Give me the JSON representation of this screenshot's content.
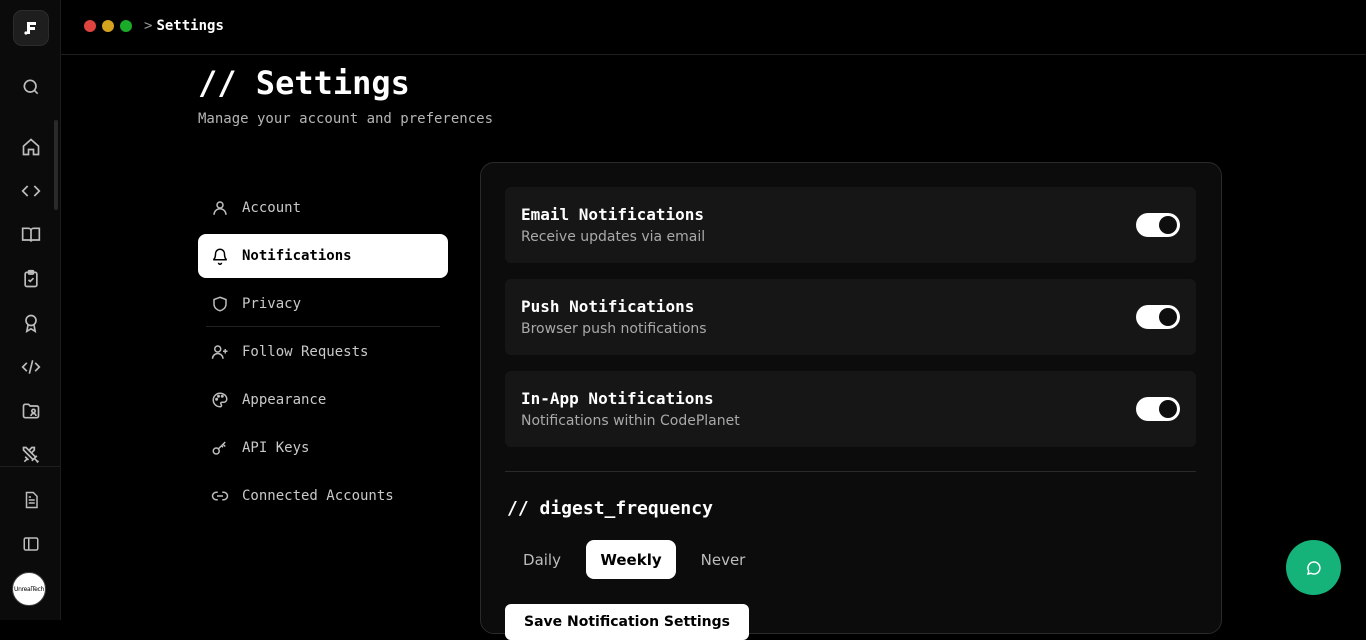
{
  "breadcrumb": {
    "separator": ">",
    "current": "Settings"
  },
  "window_controls": [
    "#e0443e",
    "#d6a31f",
    "#1aab29"
  ],
  "rail": {
    "icons": [
      "search-icon",
      "home-icon",
      "code-icon",
      "book-icon",
      "clipboard-check-icon",
      "award-icon",
      "code-tag-icon",
      "folder-user-icon",
      "swords-icon",
      "document-icon",
      "sidebar-toggle-icon"
    ],
    "avatar_text": "UnrealTech"
  },
  "header": {
    "title": "// Settings",
    "subtitle": "Manage your account and preferences"
  },
  "nav": {
    "items": [
      {
        "label": "Account",
        "icon": "user-icon"
      },
      {
        "label": "Notifications",
        "icon": "bell-icon",
        "active": true
      },
      {
        "label": "Privacy",
        "icon": "shield-icon"
      },
      {
        "label": "Follow Requests",
        "icon": "user-plus-icon"
      },
      {
        "label": "Appearance",
        "icon": "palette-icon"
      },
      {
        "label": "API Keys",
        "icon": "key-icon"
      },
      {
        "label": "Connected Accounts",
        "icon": "link-icon"
      }
    ]
  },
  "notifications": [
    {
      "title": "Email Notifications",
      "desc": "Receive updates via email",
      "enabled": true
    },
    {
      "title": "Push Notifications",
      "desc": "Browser push notifications",
      "enabled": true
    },
    {
      "title": "In-App Notifications",
      "desc": "Notifications within CodePlanet",
      "enabled": true
    }
  ],
  "digest": {
    "heading": "// digest_frequency",
    "options": [
      "Daily",
      "Weekly",
      "Never"
    ],
    "selected": "Weekly"
  },
  "save_button": "Save Notification Settings",
  "colors": {
    "accent": "#15b27a",
    "background": "#000000",
    "card": "#161616"
  }
}
